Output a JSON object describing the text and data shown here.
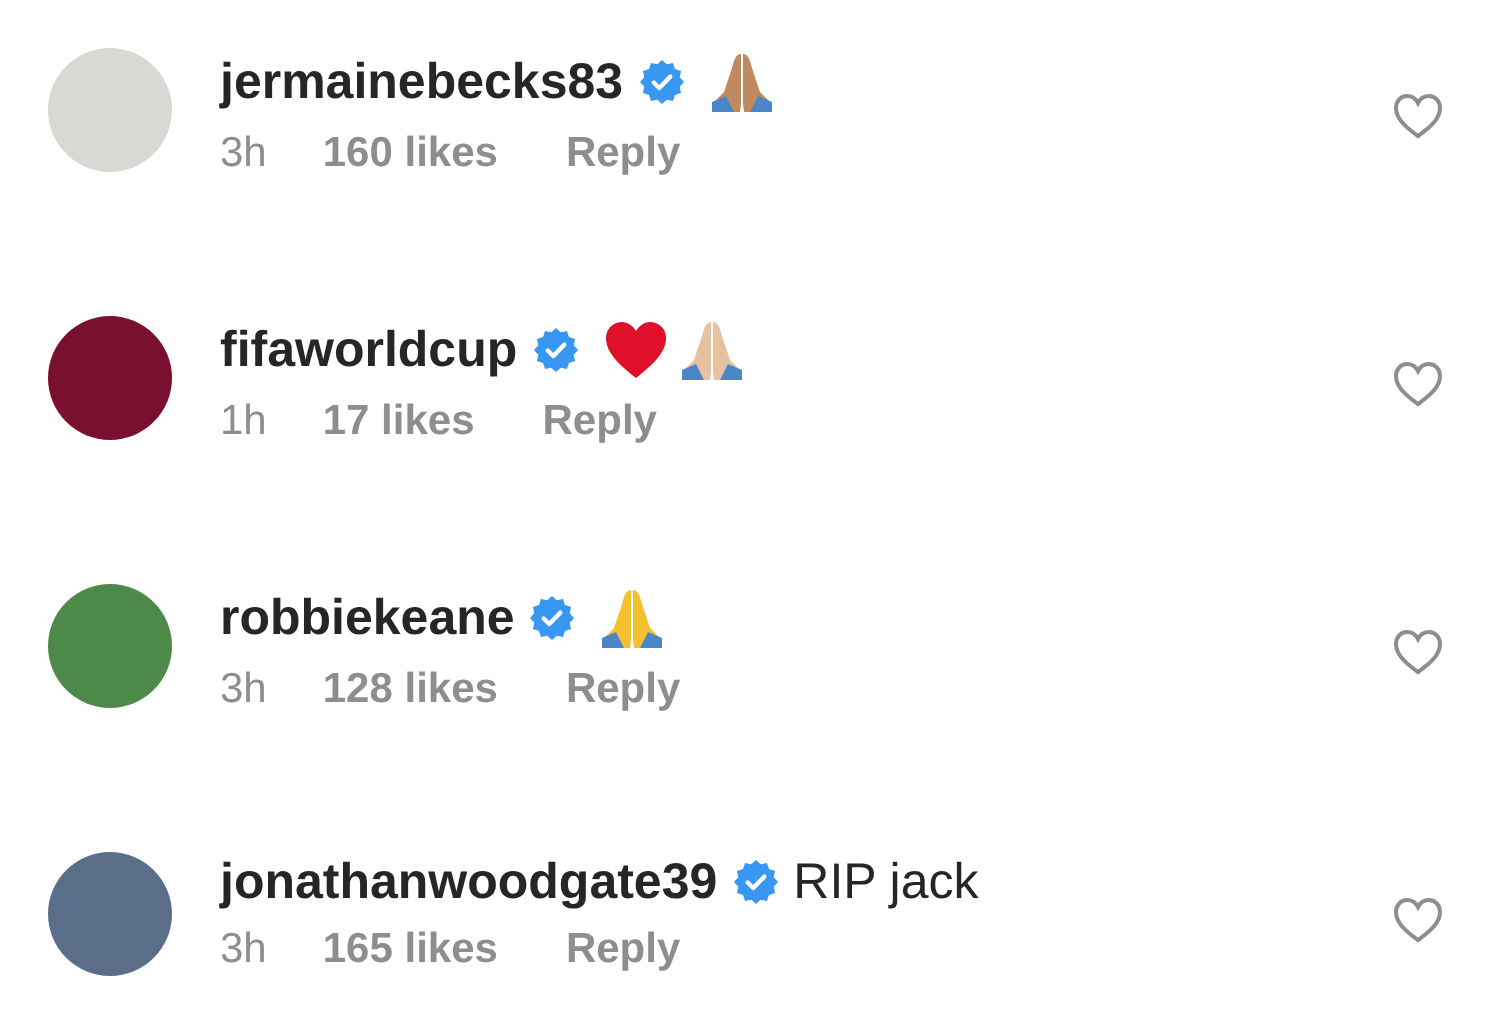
{
  "comments": [
    {
      "username": "jermainebecks83",
      "verified": true,
      "color": "#d8d8d4",
      "emojis": [
        {
          "kind": "pray",
          "color": "#c08a5e"
        }
      ],
      "time": "3h",
      "likes": "160 likes",
      "reply": "Reply",
      "liked": false
    },
    {
      "username": "fifaworldcup",
      "verified": true,
      "color": "#7a1030",
      "emojis": [
        {
          "kind": "heart",
          "color": "#e0102a"
        },
        {
          "kind": "pray",
          "color": "#e6c2a0"
        }
      ],
      "time": "1h",
      "likes": "17 likes",
      "reply": "Reply",
      "liked": false
    },
    {
      "username": "robbiekeane",
      "verified": true,
      "color": "#4d8a4a",
      "emojis": [
        {
          "kind": "pray",
          "color": "#f5c030"
        }
      ],
      "time": "3h",
      "likes": "128 likes",
      "reply": "Reply",
      "liked": false
    },
    {
      "username": "jonathanwoodgate39",
      "verified": true,
      "color": "#5a6e8a",
      "text": "RIP jack",
      "time": "3h",
      "likes": "165 likes",
      "reply": "Reply",
      "liked": false
    }
  ]
}
